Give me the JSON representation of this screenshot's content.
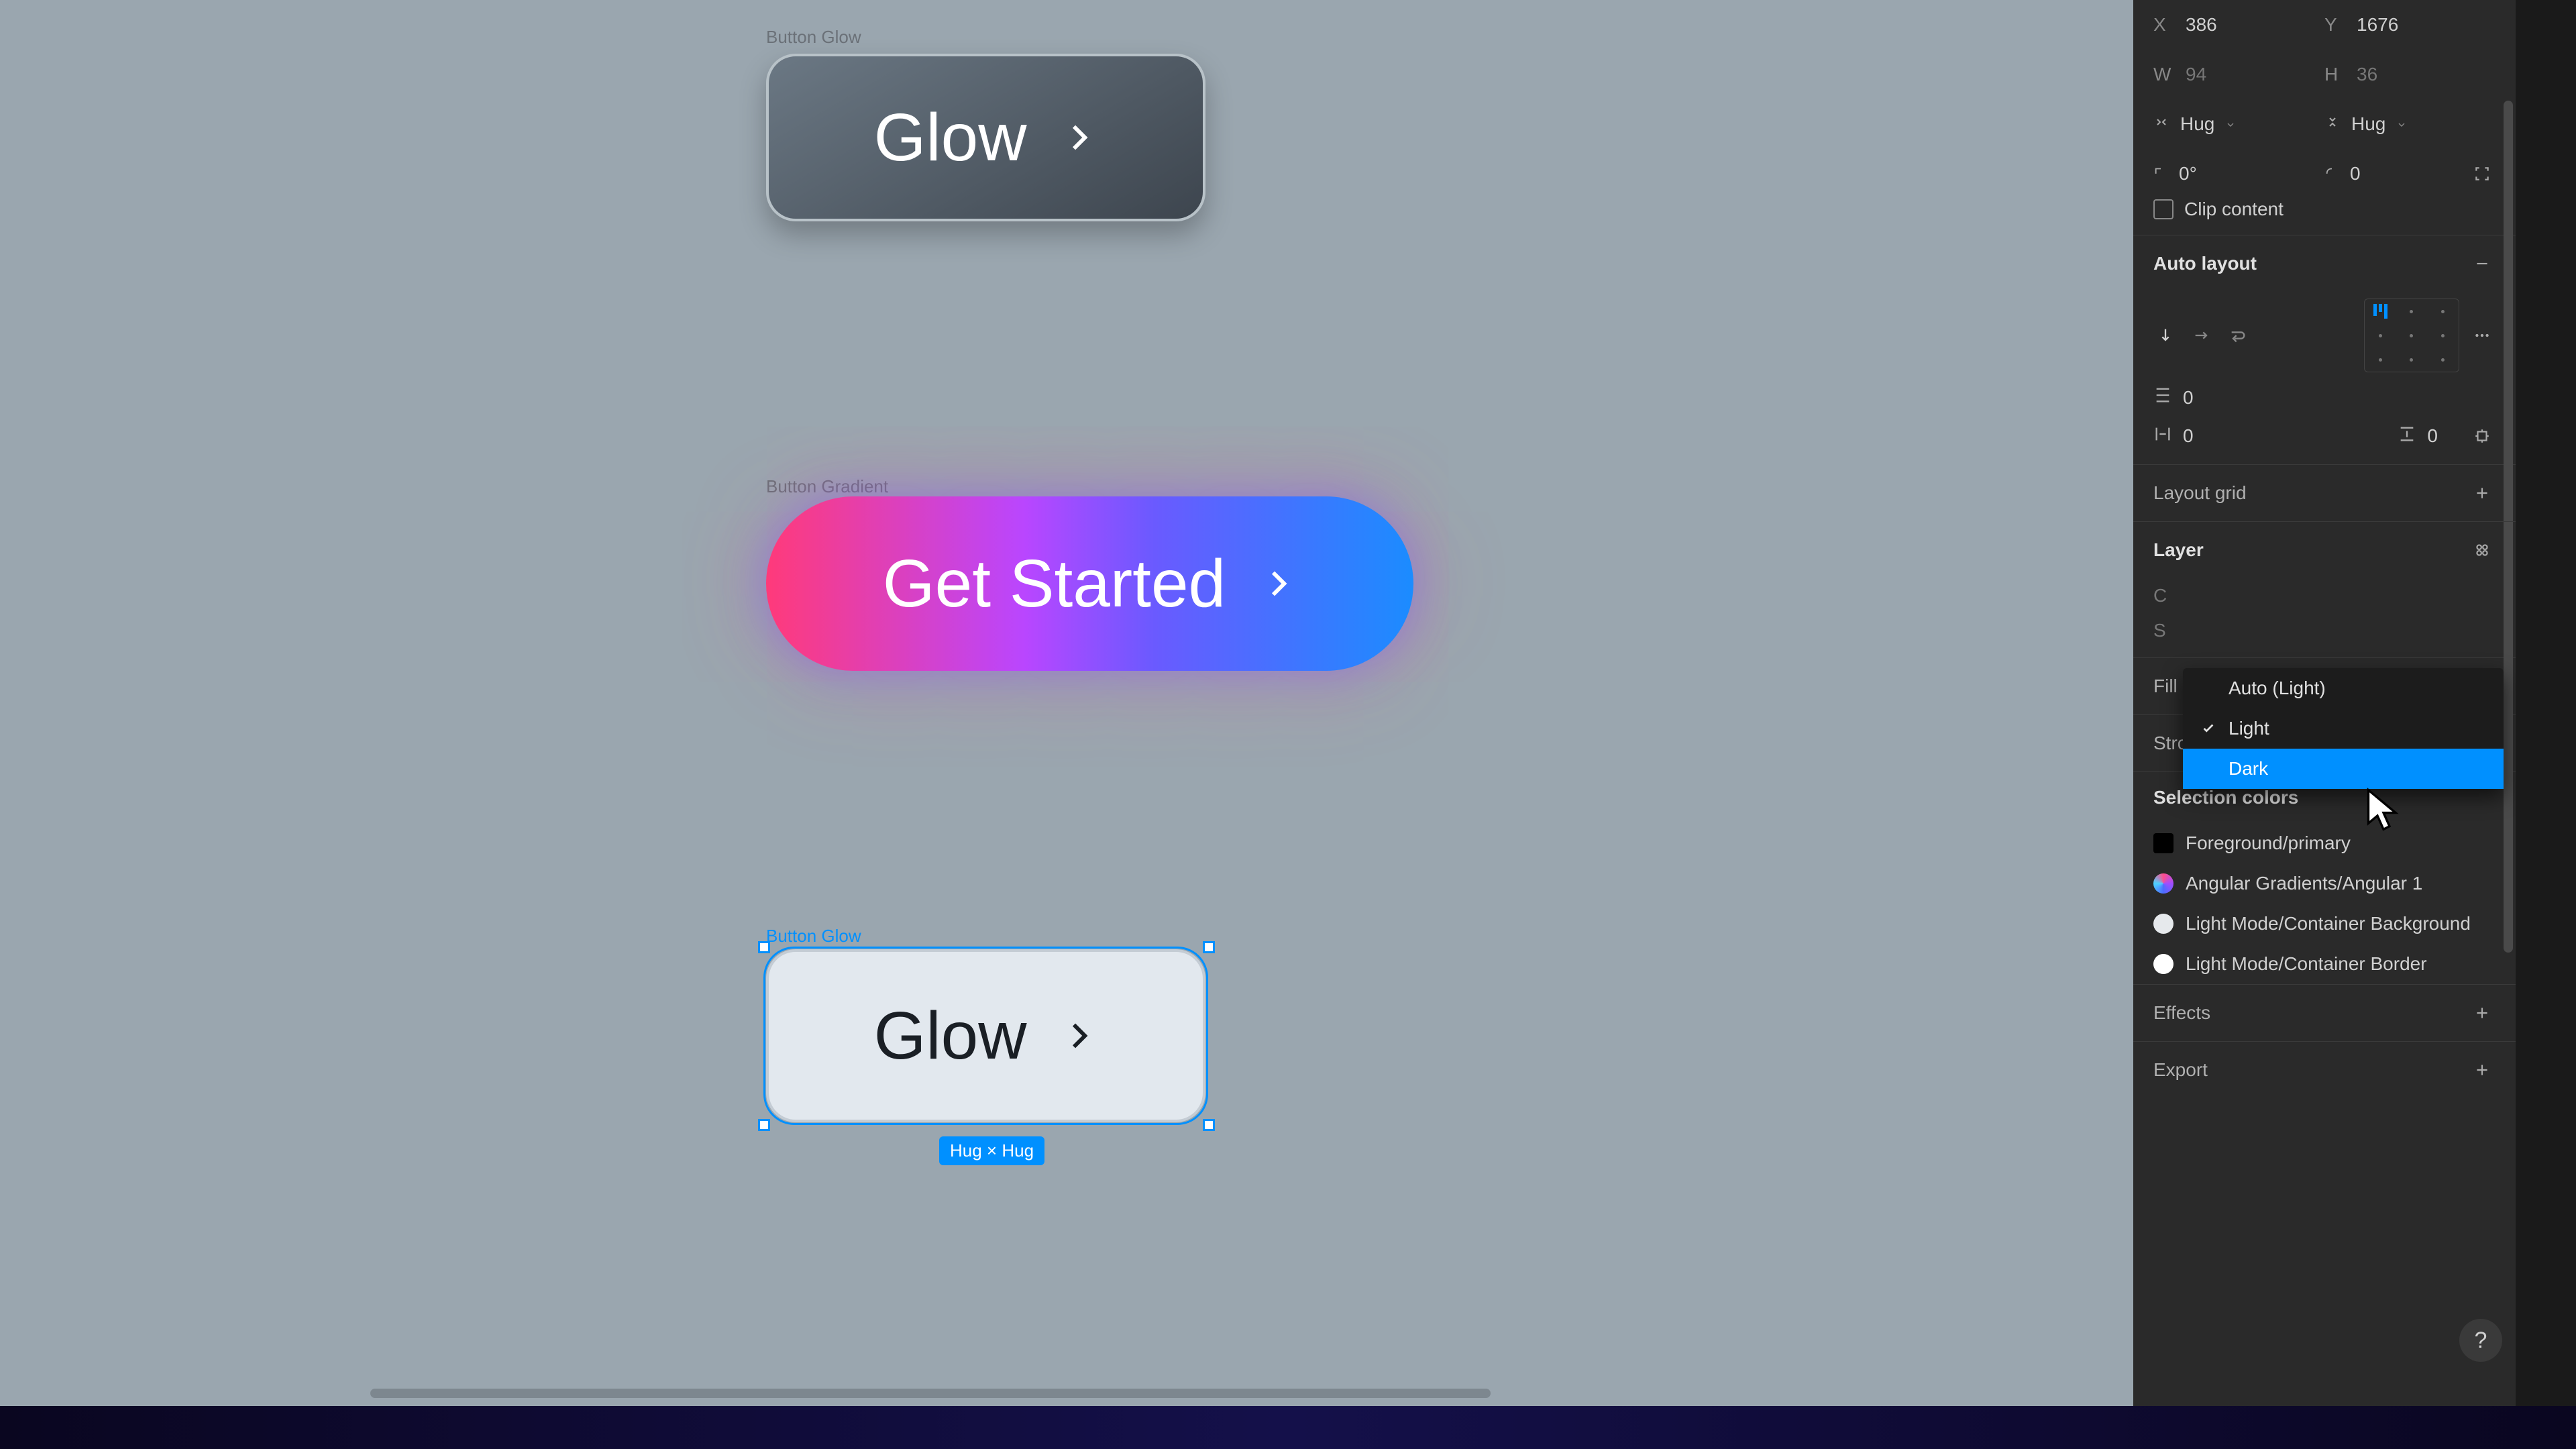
{
  "canvas": {
    "labels": {
      "glow_dark": "Button Glow",
      "gradient": "Button Gradient",
      "glow_light": "Button Glow"
    },
    "buttons": {
      "glow_dark": "Glow",
      "gradient": "Get Started",
      "glow_light": "Glow"
    },
    "selection_badge": "Hug × Hug"
  },
  "panel": {
    "x_label": "X",
    "x_value": "386",
    "y_label": "Y",
    "y_value": "1676",
    "w_label": "W",
    "w_value": "94",
    "h_label": "H",
    "h_value": "36",
    "sizing_x": "Hug",
    "sizing_y": "Hug",
    "rotation": "0°",
    "corner": "0",
    "clip_content": "Clip content",
    "auto_layout": "Auto layout",
    "al_gap": "0",
    "al_pad_h": "0",
    "al_pad_v": "0",
    "layout_grid": "Layout grid",
    "layer": "Layer",
    "fill": "Fill",
    "stroke": "Stroke",
    "selection_colors": "Selection colors",
    "effects": "Effects",
    "export": "Export",
    "colors": [
      {
        "name": "Foreground/primary",
        "hex": "#000000"
      },
      {
        "name": "Angular Gradients/Angular 1",
        "hex": "conic"
      },
      {
        "name": "Light Mode/Container Background",
        "hex": "#e6e9ec"
      },
      {
        "name": "Light Mode/Container Border",
        "hex": "#ffffff"
      }
    ],
    "hidden_letters": {
      "c": "C",
      "s": "S"
    },
    "dropdown": {
      "auto": "Auto (Light)",
      "light": "Light",
      "dark": "Dark"
    }
  },
  "help": "?"
}
